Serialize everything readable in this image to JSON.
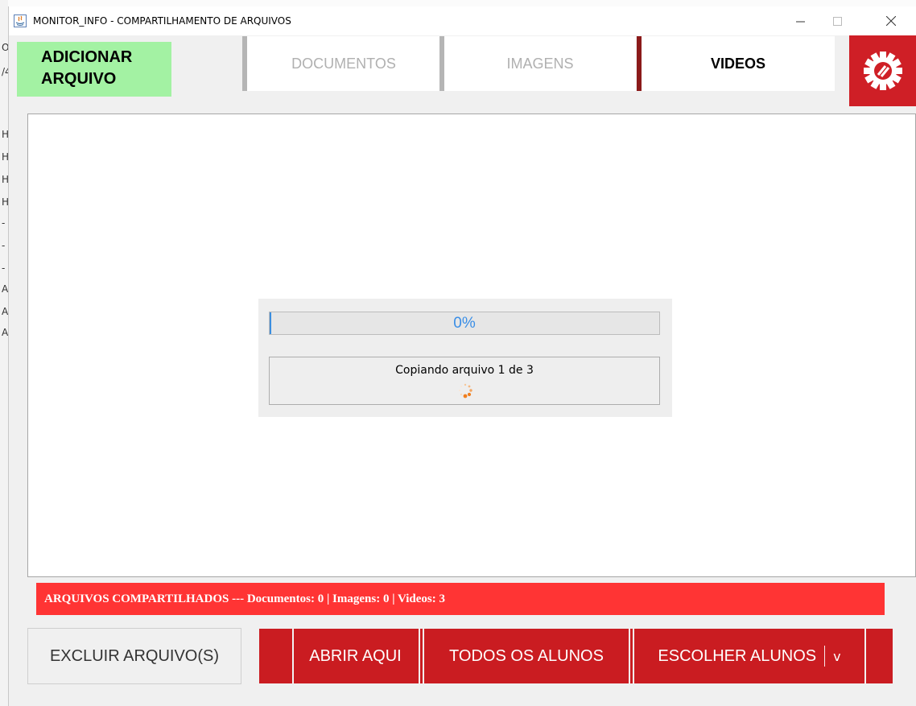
{
  "window": {
    "title": "MONITOR_INFO - COMPARTILHAMENTO DE ARQUIVOS"
  },
  "toolbar": {
    "add_label_line1": "ADICIONAR",
    "add_label_line2": "ARQUIVO",
    "tabs": [
      {
        "label": "DOCUMENTOS",
        "active": false
      },
      {
        "label": "IMAGENS",
        "active": false
      },
      {
        "label": "VIDEOS",
        "active": true
      }
    ],
    "settings_icon": "gear-icon"
  },
  "progress": {
    "percent_text": "0%",
    "fraction": 0,
    "status_text": "Copiando arquivo 1 de 3"
  },
  "summary": {
    "text": "ARQUIVOS COMPARTILHADOS --- Documentos: 0 | Imagens: 0 | Videos: 3"
  },
  "actions": {
    "delete_label": "EXCLUIR ARQUIVO(S)",
    "open_here_label": "ABRIR AQUI",
    "all_students_label": "TODOS OS ALUNOS",
    "choose_students_label": "ESCOLHER ALUNOS",
    "dropdown_arrow": "v"
  },
  "colors": {
    "accent_red": "#ca1c21",
    "summary_red": "#ff3434",
    "add_green": "#a3f2a3",
    "progress_blue": "#3a8ee6",
    "spinner_orange": "#f07f1f"
  }
}
